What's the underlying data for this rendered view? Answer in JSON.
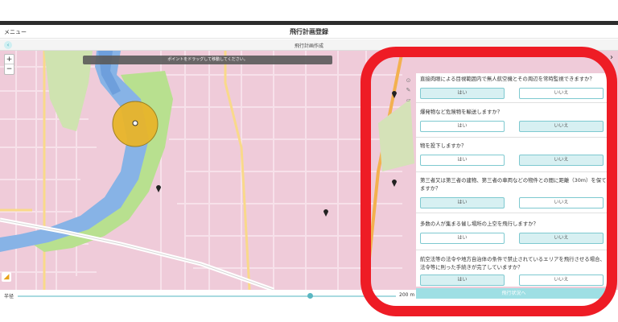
{
  "header": {
    "menu": "メニュー",
    "title": "飛行計画登録"
  },
  "subheader": {
    "title": "飛行計画作成"
  },
  "map": {
    "hint": "ポイントをドラッグして移動してください。",
    "zoom_in": "+",
    "zoom_out": "−",
    "chevron": "›",
    "tools": [
      "⊙",
      "✎",
      "▱"
    ]
  },
  "questions": [
    {
      "text": "直接肉眼による目視範囲内で無人航空機とその周辺を常時監視できますか？",
      "yes": "はい",
      "no": "いいえ",
      "selected": "yes"
    },
    {
      "text": "爆発物など危険物を輸送しますか？",
      "yes": "はい",
      "no": "いいえ",
      "selected": "no"
    },
    {
      "text": "物を投下しますか？",
      "yes": "はい",
      "no": "いいえ",
      "selected": "no"
    },
    {
      "text": "第三者又は第三者の建物、第三者の車両などの物件との間に距離（30m）を保てますか？",
      "yes": "はい",
      "no": "いいえ",
      "selected": "yes"
    },
    {
      "text": "多数の人が集まる催し場所の上空を飛行しますか？",
      "yes": "はい",
      "no": "いいえ",
      "selected": "no"
    },
    {
      "text": "航空法等の法令や地方自治体の条件で禁止されているエリアを飛行させる場合、法令等に則った手続きが完了していますか？",
      "yes": "はい",
      "no": "いいえ",
      "selected": "yes"
    }
  ],
  "submit_label": "飛行状況へ",
  "scale": {
    "label": "半径",
    "value": "200 m",
    "fraction": 0.77
  },
  "colors": {
    "accent": "#5ab7c2",
    "highlight": "#ee1c25",
    "marker": "#e8b52a"
  }
}
